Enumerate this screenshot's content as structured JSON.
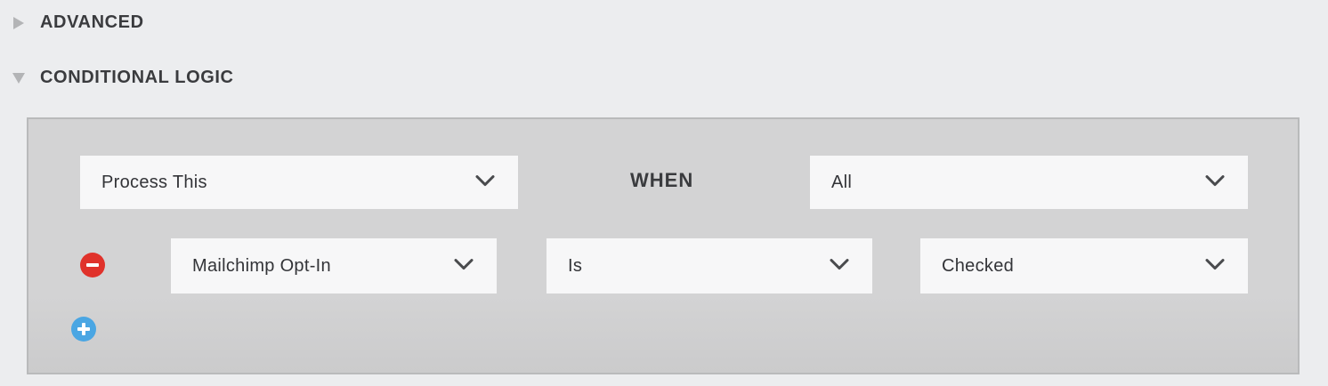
{
  "sections": {
    "advanced": {
      "title": "ADVANCED",
      "expanded": false,
      "icon": "triangle-right-icon"
    },
    "conditional_logic": {
      "title": "CONDITIONAL LOGIC",
      "expanded": true,
      "icon": "triangle-down-icon"
    }
  },
  "logic": {
    "action": {
      "value": "Process This"
    },
    "when_label": "WHEN",
    "match": {
      "value": "All"
    },
    "conditions": [
      {
        "field": "Mailchimp Opt-In",
        "operator": "Is",
        "value": "Checked"
      }
    ]
  },
  "colors": {
    "remove_button": "#e0322b",
    "add_button": "#4aa6e3",
    "panel_bg": "#d3d3d4",
    "select_bg": "#f7f7f8"
  }
}
